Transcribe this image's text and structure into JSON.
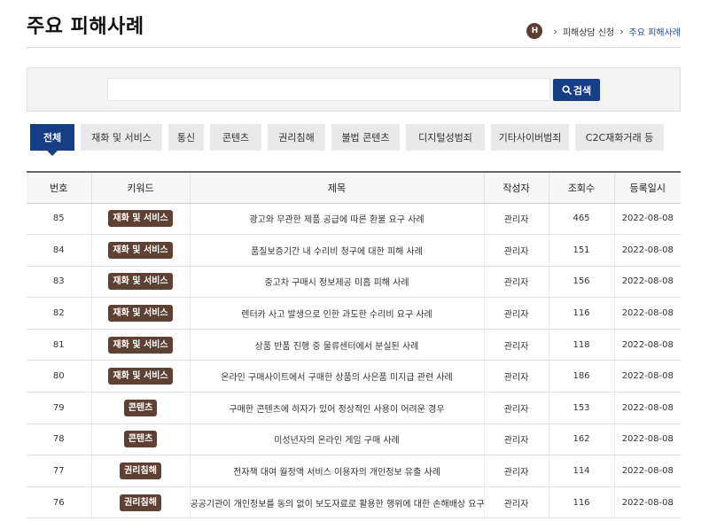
{
  "header": {
    "title": "주요 피해사례",
    "breadcrumb": {
      "home_label": "H",
      "parent": "피해상담 신청",
      "current": "주요 피해사례"
    }
  },
  "search": {
    "value": "",
    "placeholder": "",
    "button_label": "검색"
  },
  "tabs": [
    {
      "label": "전체",
      "active": true
    },
    {
      "label": "재화 및 서비스",
      "active": false
    },
    {
      "label": "통신",
      "active": false
    },
    {
      "label": "콘텐츠",
      "active": false
    },
    {
      "label": "권리침해",
      "active": false
    },
    {
      "label": "불법 콘텐츠",
      "active": false
    },
    {
      "label": "디지털성범죄",
      "active": false
    },
    {
      "label": "기타사이버범죄",
      "active": false
    },
    {
      "label": "C2C재화거래 등",
      "active": false
    }
  ],
  "table": {
    "columns": [
      "번호",
      "키워드",
      "제목",
      "작성자",
      "조회수",
      "등록일시"
    ],
    "rows": [
      {
        "no": "85",
        "keyword": "재화 및 서비스",
        "title": "광고와 무관한 제품 공급에 따른 환불 요구 사례",
        "author": "관리자",
        "views": "465",
        "date": "2022-08-08"
      },
      {
        "no": "84",
        "keyword": "재화 및 서비스",
        "title": "품질보증기간 내 수리비 청구에 대한 피해 사례",
        "author": "관리자",
        "views": "151",
        "date": "2022-08-08"
      },
      {
        "no": "83",
        "keyword": "재화 및 서비스",
        "title": "중고차 구매시 정보제공 미흡 피해 사례",
        "author": "관리자",
        "views": "156",
        "date": "2022-08-08"
      },
      {
        "no": "82",
        "keyword": "재화 및 서비스",
        "title": "렌터카 사고 발생으로 인한 과도한 수리비 요구 사례",
        "author": "관리자",
        "views": "116",
        "date": "2022-08-08"
      },
      {
        "no": "81",
        "keyword": "재화 및 서비스",
        "title": "상품 반품 진행 중 물류센터에서 분실된 사례",
        "author": "관리자",
        "views": "118",
        "date": "2022-08-08"
      },
      {
        "no": "80",
        "keyword": "재화 및 서비스",
        "title": "온라인 구매사이트에서 구매한 상품의 사은품 미지급 관련 사례",
        "author": "관리자",
        "views": "186",
        "date": "2022-08-08"
      },
      {
        "no": "79",
        "keyword": "콘텐츠",
        "title": "구매한 콘텐츠에 하자가 있어 정상적인 사용이 어려운 경우",
        "author": "관리자",
        "views": "153",
        "date": "2022-08-08"
      },
      {
        "no": "78",
        "keyword": "콘텐츠",
        "title": "미성년자의 온라인 게임 구매 사례",
        "author": "관리자",
        "views": "162",
        "date": "2022-08-08"
      },
      {
        "no": "77",
        "keyword": "권리침해",
        "title": "전자책 대여 월정액 서비스 이용자의 개인정보 유출 사례",
        "author": "관리자",
        "views": "114",
        "date": "2022-08-08"
      },
      {
        "no": "76",
        "keyword": "권리침해",
        "title": "공공기관이 개인정보를 동의 없이 보도자료로 활용한 행위에 대한 손해배상 요구",
        "author": "관리자",
        "views": "116",
        "date": "2022-08-08"
      }
    ]
  },
  "colors": {
    "accent": "#173d84",
    "badge": "#5e4134",
    "breadcrumb_current": "#1f4a8f"
  }
}
